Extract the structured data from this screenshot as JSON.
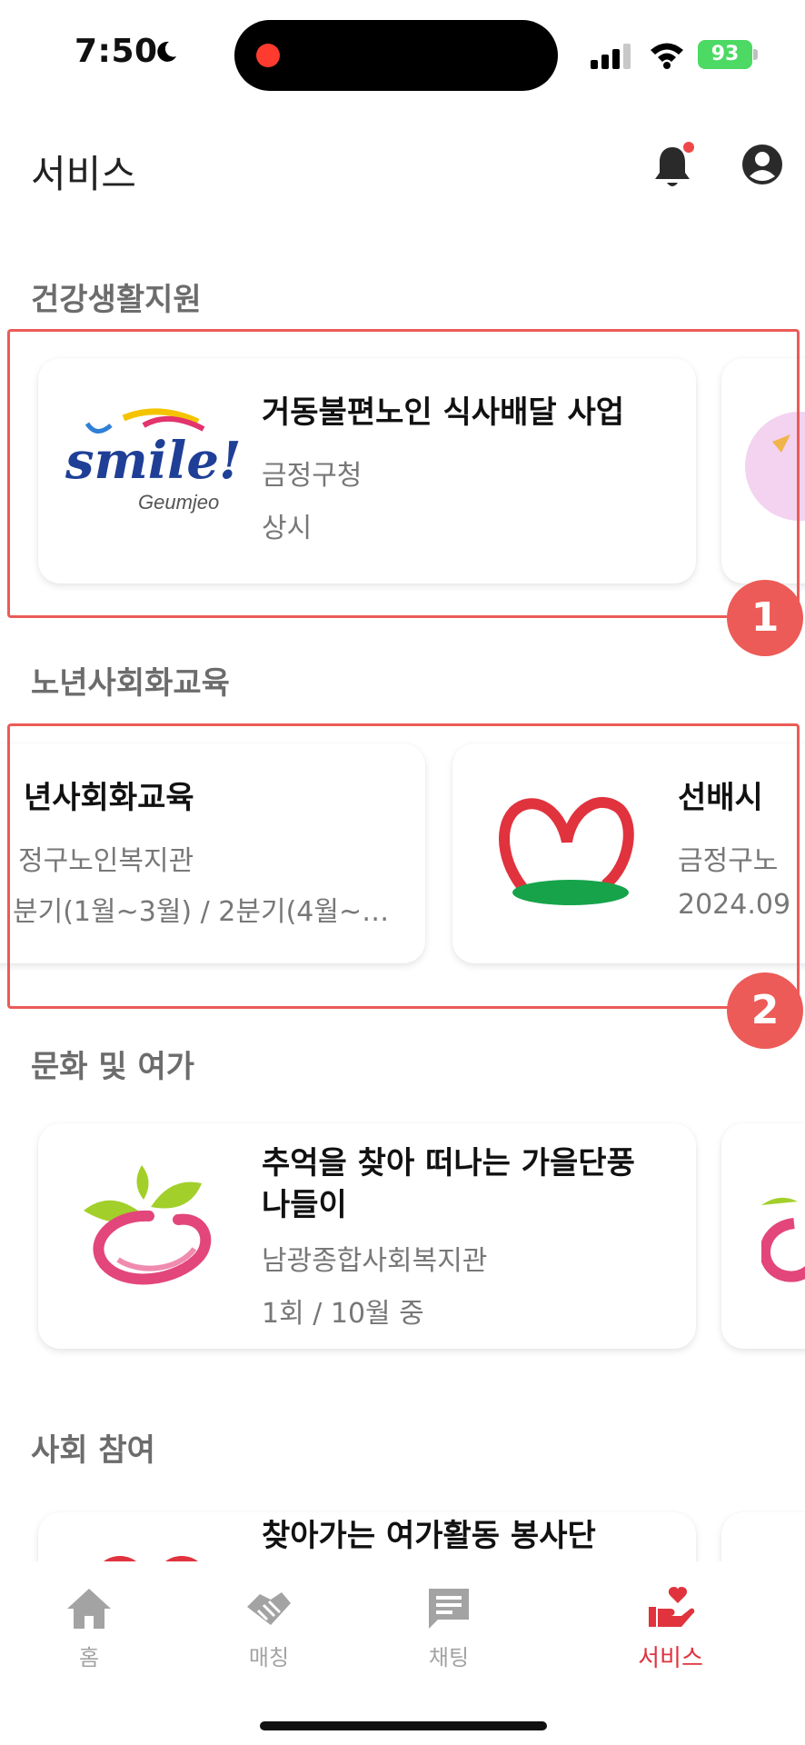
{
  "status_bar": {
    "time": "7:50",
    "battery": "93"
  },
  "header": {
    "title": "서비스"
  },
  "sections": [
    {
      "title": "건강생활지원",
      "cards": [
        {
          "title": "거동불편노인 식사배달 사업",
          "org": "금정구청",
          "period": "상시",
          "logo_text": "smile!",
          "logo_sub": "Geumjeo"
        }
      ]
    },
    {
      "title": "노년사회화교육",
      "cards": [
        {
          "title": "년사회화교육",
          "org": "정구노인복지관",
          "period": "분기(1월~3월) / 2분기(4월~…"
        },
        {
          "title": "선배시",
          "org": "금정구노",
          "period": "2024.09"
        }
      ]
    },
    {
      "title": "문화 및 여가",
      "cards": [
        {
          "title_line1": "추억을 찾아 떠나는 가을단풍",
          "title_line2": "나들이",
          "org": "남광종합사회복지관",
          "period": "1회 / 10월 중"
        }
      ]
    },
    {
      "title": "사회 참여",
      "cards": [
        {
          "title": "찾아가는 여가활동 봉사단"
        }
      ]
    }
  ],
  "annotations": {
    "badge1": "1",
    "badge2": "2"
  },
  "bottom_nav": [
    {
      "label": "홈",
      "active": false
    },
    {
      "label": "매칭",
      "active": false
    },
    {
      "label": "채팅",
      "active": false
    },
    {
      "label": "서비스",
      "active": true
    }
  ],
  "colors": {
    "accent": "#e0333e",
    "highlight": "#ec5b57",
    "inactive": "#a3a3a3"
  },
  "icons": {
    "home": "home-icon",
    "matching": "handshake-icon",
    "chat": "chat-icon",
    "service": "heart-hand-icon",
    "bell": "bell-icon",
    "profile": "profile-icon"
  }
}
